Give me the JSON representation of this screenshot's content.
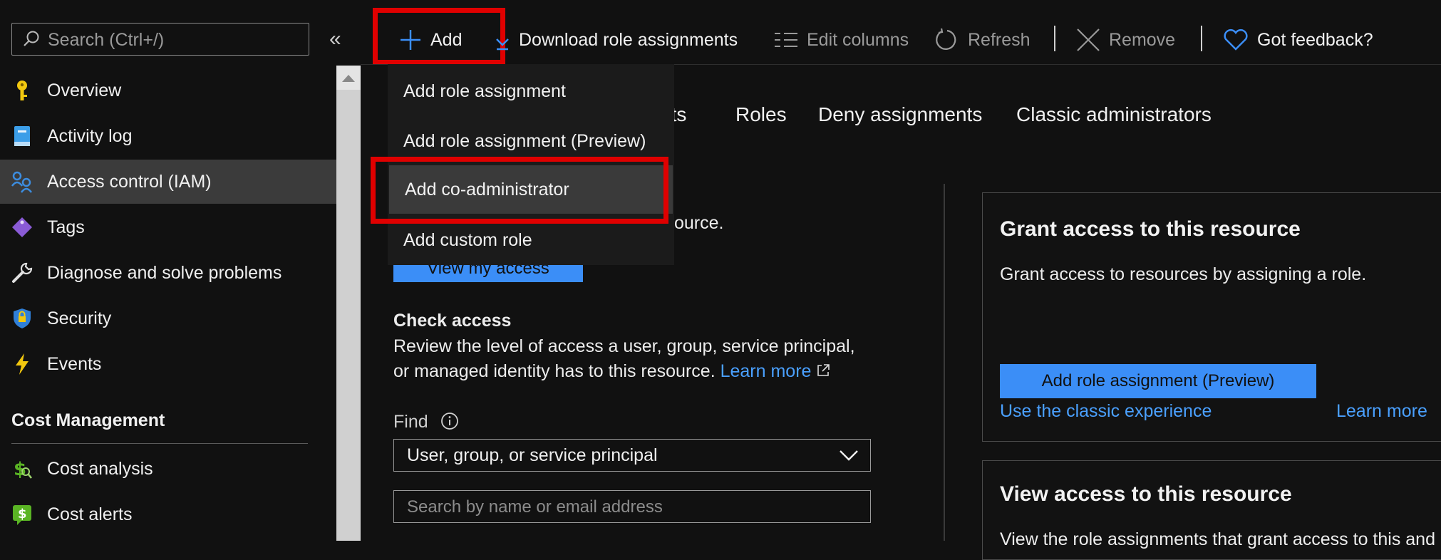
{
  "sidebar": {
    "search_placeholder": "Search (Ctrl+/)",
    "collapse_label": "«",
    "items": [
      {
        "label": "Overview",
        "icon": "key-icon"
      },
      {
        "label": "Activity log",
        "icon": "log-book-icon"
      },
      {
        "label": "Access control (IAM)",
        "icon": "people-icon",
        "active": true
      },
      {
        "label": "Tags",
        "icon": "tag-icon"
      },
      {
        "label": "Diagnose and solve problems",
        "icon": "wrench-icon"
      },
      {
        "label": "Security",
        "icon": "shield-icon"
      },
      {
        "label": "Events",
        "icon": "lightning-icon"
      }
    ],
    "section_title": "Cost Management",
    "section_items": [
      {
        "label": "Cost analysis",
        "icon": "cost-analysis-icon"
      },
      {
        "label": "Cost alerts",
        "icon": "cost-alert-icon"
      }
    ]
  },
  "toolbar": {
    "add_label": "Add",
    "download_label": "Download role assignments",
    "edit_columns_label": "Edit columns",
    "refresh_label": "Refresh",
    "remove_label": "Remove",
    "feedback_label": "Got feedback?"
  },
  "add_menu": {
    "items": [
      "Add role assignment",
      "Add role assignment (Preview)",
      "Add co-administrator",
      "Add custom role"
    ],
    "highlighted_index": 2
  },
  "tabs": {
    "partial_label": "nts",
    "roles": "Roles",
    "deny": "Deny assignments",
    "classic": "Classic administrators"
  },
  "main": {
    "partial_text": "ource.",
    "view_my_access_button": "View my access",
    "check_access_title": "Check access",
    "check_access_line1": "Review the level of access a user, group, service principal,",
    "check_access_line2": "or managed identity has to this resource.",
    "learn_more": "Learn more",
    "find_label": "Find",
    "find_select_value": "User, group, or service principal",
    "search_placeholder": "Search by name or email address"
  },
  "grant_card": {
    "title": "Grant access to this resource",
    "description": "Grant access to resources by assigning a role.",
    "button": "Add role assignment (Preview)",
    "classic_link": "Use the classic experience",
    "learn_more": "Learn more"
  },
  "view_card": {
    "title": "View access to this resource",
    "description_partial": "View the role assignments that grant access to this and"
  },
  "colors": {
    "background": "#111111",
    "accent_blue": "#3b8ef7",
    "link_blue": "#4aa0ff",
    "highlight_red": "#e00000"
  }
}
